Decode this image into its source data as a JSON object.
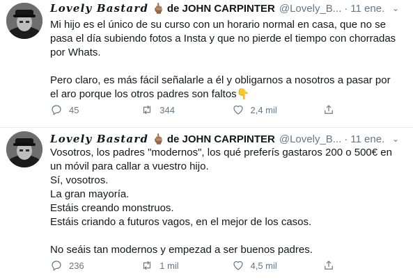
{
  "tweets": [
    {
      "author": {
        "display_name": "Lovely Bastard",
        "emoji": "🖕🏽",
        "name_suffix": "de JOHN CARPINTER",
        "handle": "@Lovely_B...",
        "separator": "·",
        "time": "11 ene."
      },
      "text_paragraphs": [
        [
          "Mi hijo es el único de su curso con un horario normal en casa, que no se",
          "pasa el día subiendo fotos a Insta y que no pierde el tiempo con chorradas",
          "por Whats."
        ],
        [
          "Pero claro, es más fácil señalarle a él y obligarnos a nosotros a pasar por",
          "el aro porque los otros padres son faltos👇"
        ]
      ],
      "replies": "45",
      "retweets": "344",
      "likes": "2,4 mil"
    },
    {
      "author": {
        "display_name": "Lovely Bastard",
        "emoji": "🖕🏽",
        "name_suffix": "de JOHN CARPINTER",
        "handle": "@Lovely_B...",
        "separator": "·",
        "time": "11 ene."
      },
      "text_paragraphs": [
        [
          "Vosotros, los padres \"modernos\", los qué preferís gastaros 200 o 500€ en",
          "un móvil para callar a vuestro hijo.",
          "Sí, vosotros.",
          "La gran mayoría.",
          "Estáis creando monstruos.",
          "Estáis criando a futuros vagos, en el mejor de los casos."
        ],
        [
          "No seáis tan modernos y empezad a ser buenos padres."
        ]
      ],
      "replies": "236",
      "retweets": "1 mil",
      "likes": "4,5 mil"
    }
  ]
}
